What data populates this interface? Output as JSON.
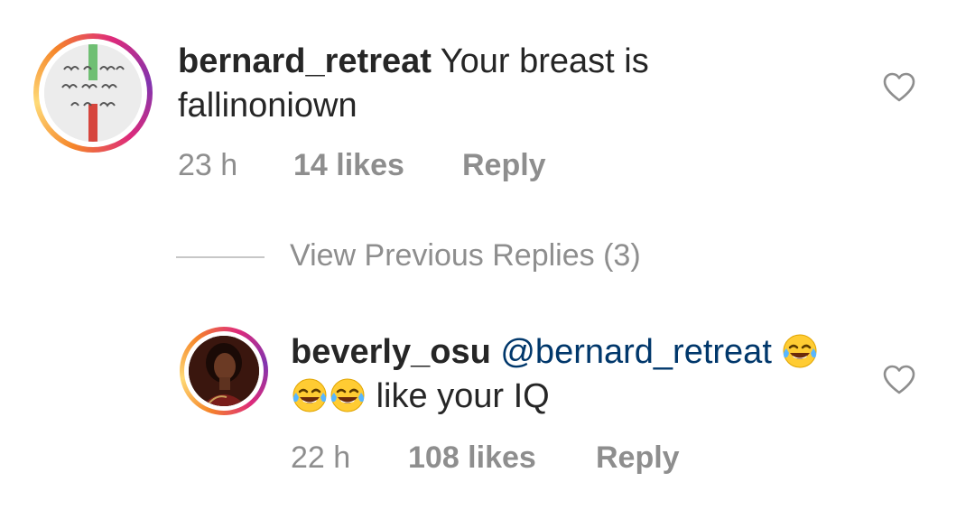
{
  "comments": [
    {
      "username": "bernard_retreat",
      "text": "Your breast is fallinoniown",
      "time": "23 h",
      "likes": "14 likes",
      "reply_label": "Reply",
      "avatar": "sign-language-hands-avatar",
      "liked": false
    },
    {
      "username": "beverly_osu",
      "mention": "@bernard_retreat",
      "text": "like your IQ",
      "emoji": "face-with-tears-of-joy",
      "time": "22 h",
      "likes": "108 likes",
      "reply_label": "Reply",
      "avatar": "woman-portrait-avatar",
      "liked": false
    }
  ],
  "view_previous_replies": "View Previous Replies (3)",
  "colors": {
    "text": "#262626",
    "secondary": "#8e8e8e",
    "mention": "#00376b",
    "story_ring_start": "#f58529",
    "story_ring_end": "#dd2a7b"
  },
  "icons": [
    "heart-icon",
    "heart-icon"
  ]
}
